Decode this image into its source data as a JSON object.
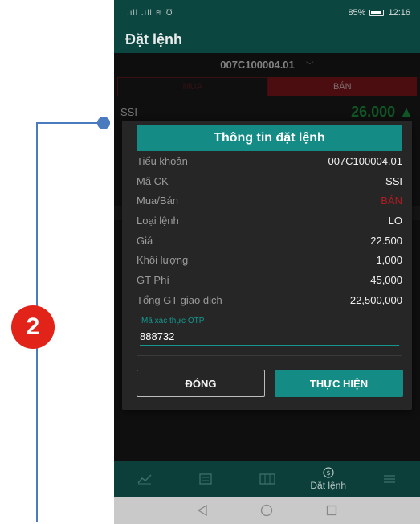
{
  "annotation": {
    "step_number": "2"
  },
  "status_bar": {
    "signal": ".ıll .ıll ≋ ℧",
    "battery": "85%",
    "time": "12:16"
  },
  "app_bar": {
    "title": "Đặt lệnh"
  },
  "account": {
    "number": "007C100004.01"
  },
  "order_side": {
    "buy_label": "MUA",
    "sell_label": "BÁN"
  },
  "symbol_row": {
    "symbol": "SSI",
    "price": "26.000 ▲"
  },
  "dialog": {
    "title": "Thông tin đặt lệnh",
    "rows": [
      {
        "label": "Tiểu khoản",
        "value": "007C100004.01"
      },
      {
        "label": "Mã CK",
        "value": "SSI"
      },
      {
        "label": "Mua/Bán",
        "value": "BÁN"
      },
      {
        "label": "Loại lệnh",
        "value": "LO"
      },
      {
        "label": "Giá",
        "value": "22.500"
      },
      {
        "label": "Khối lượng",
        "value": "1,000"
      },
      {
        "label": "GT Phí",
        "value": "45,000"
      },
      {
        "label": "Tổng GT giao dịch",
        "value": "22,500,000"
      }
    ],
    "otp_label": "Mã xác thực OTP",
    "otp_value": "888732",
    "close_button": "ĐÓNG",
    "execute_button": "THỰC HIỆN"
  },
  "bottom_nav": {
    "active_label": "Đặt lệnh"
  },
  "colors": {
    "accent": "#158b86",
    "sell": "#b01c22",
    "price_up": "#1e9e45"
  }
}
